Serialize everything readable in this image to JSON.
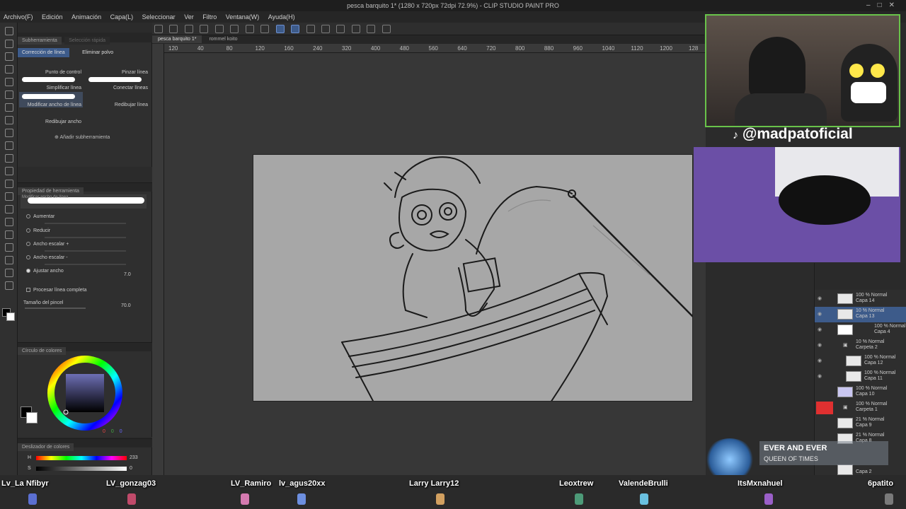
{
  "window": {
    "title": "pesca barquito 1* (1280 x 720px 72dpi 72.9%)  - CLIP STUDIO PAINT PRO"
  },
  "menu": [
    "Archivo(F)",
    "Edición",
    "Animación",
    "Capa(L)",
    "Seleccionar",
    "Ver",
    "Filtro",
    "Ventana(W)",
    "Ayuda(H)"
  ],
  "subtool": {
    "panel_tabs": [
      "Subherramienta",
      "Selección rápida"
    ],
    "tabs": [
      "Corrección de línea",
      "Eliminar polvo"
    ],
    "items": [
      "Punto de control",
      "Pinzar línea",
      "Simplificar línea",
      "Conectar líneas",
      "Modificar ancho de línea",
      "Redibujar línea",
      "Redibujar ancho"
    ],
    "add_label": "Añadir subherramienta"
  },
  "tool_property": {
    "header": "Propiedad de herramienta",
    "brush_name": "Modificar ancho de línea",
    "options": [
      "Aumentar",
      "Reducir",
      "Ancho escalar +",
      "Ancho escalar -",
      "Ajustar ancho"
    ],
    "selected_option": "Ajustar ancho",
    "width_value": "7.0",
    "checkbox_label": "Procesar línea completa",
    "brush_size_label": "Tamaño del pincel",
    "brush_size_value": "70.0"
  },
  "color_wheel": {
    "header": "Círculo de colores",
    "values": [
      "0",
      "0",
      "0"
    ]
  },
  "color_slider": {
    "header": "Deslizador de colores",
    "h_label": "H",
    "h_value": "233",
    "s_label": "S",
    "s_value": "0"
  },
  "doc_tabs": [
    "pesca barquito 1*",
    "rommel koito"
  ],
  "ruler_ticks": [
    "120",
    "40",
    "80",
    "120",
    "160",
    "240",
    "320",
    "400",
    "480",
    "560",
    "640",
    "720",
    "800",
    "880",
    "960",
    "1040",
    "1120",
    "1200",
    "128"
  ],
  "stream": {
    "handle": "@madpatoficial",
    "now_playing_title": "EVER AND EVER",
    "now_playing_subtitle": "QUEEN OF TIMES"
  },
  "layers": [
    {
      "opacity": "100 % Normal",
      "name": "Capa 14"
    },
    {
      "opacity": "10 % Normal",
      "name": "Capa 13"
    },
    {
      "opacity": "100 % Normal",
      "name": "Capa 4"
    },
    {
      "opacity": "10 % Normal",
      "name": "Carpeta 2"
    },
    {
      "opacity": "100 % Normal",
      "name": "Capa 12"
    },
    {
      "opacity": "100 % Normal",
      "name": "Capa 11"
    },
    {
      "opacity": "100 % Normal",
      "name": "Capa 10"
    },
    {
      "opacity": "100 % Normal",
      "name": "Carpeta 1"
    },
    {
      "opacity": "21 % Normal",
      "name": "Capa 9"
    },
    {
      "opacity": "21 % Normal",
      "name": "Capa 8"
    },
    {
      "opacity": "",
      "name": "Capa 2"
    }
  ],
  "viewers": [
    "Lv_La Nfibyr",
    "LV_gonzag03",
    "LV_Ramiro",
    "lv_agus20xx",
    "Larry Larry12",
    "Leoxtrew",
    "ValendeBrulli",
    "ItsMxnahuel",
    "6patito"
  ],
  "colors": {
    "accent_blue": "#3d5b8a",
    "webcam_border": "#69c34a",
    "canvas_bg": "#a7a7a7"
  }
}
